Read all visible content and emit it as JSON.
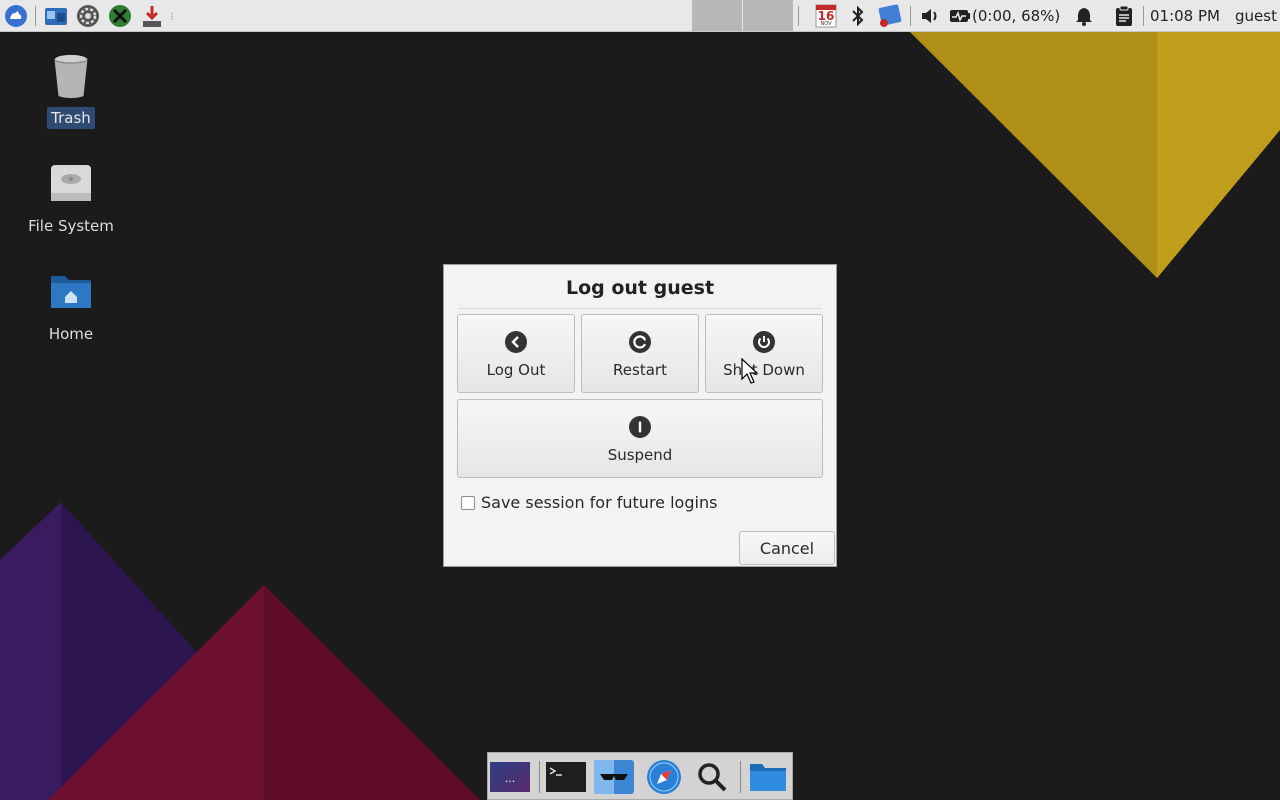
{
  "top_panel": {
    "calendar": {
      "month_top": "SAT",
      "day": "16",
      "month": "NOV"
    },
    "battery_text": "(0:00, 68%)",
    "clock": "01:08 PM",
    "user": "guest",
    "launchers": [
      "whisker-menu-icon",
      "file-manager-icon",
      "settings-icon",
      "xfce-x-icon",
      "downloader-icon"
    ],
    "tray": [
      "bluetooth-icon",
      "network-icon",
      "volume-icon",
      "battery-icon",
      "notifications-icon",
      "clipboard-icon"
    ]
  },
  "desktop": {
    "icons": [
      {
        "label": "Trash",
        "icon": "trash-icon",
        "selected": true
      },
      {
        "label": "File System",
        "icon": "drive-icon"
      },
      {
        "label": "Home",
        "icon": "home-folder-icon"
      }
    ]
  },
  "dialog": {
    "title": "Log out guest",
    "buttons": [
      {
        "label": "Log Out",
        "icon": "logout-arrow-icon"
      },
      {
        "label": "Restart",
        "icon": "restart-icon"
      },
      {
        "label": "Shut Down",
        "icon": "power-icon"
      },
      {
        "label": "Suspend",
        "icon": "suspend-icon"
      }
    ],
    "checkbox": {
      "label": "Save session for future logins",
      "checked": false
    },
    "cancel_label": "Cancel"
  },
  "dock": {
    "items": [
      "workspace-preview-icon",
      "terminal-icon",
      "finder-icon",
      "browser-compass-icon",
      "search-icon",
      "folder-icon"
    ],
    "workspace_label": "..."
  },
  "colors": {
    "desktop_bg": "#1b1b1b",
    "yellow": "#b8961b",
    "purple": "#3a1b5c",
    "crimson": "#7a1233",
    "selected_label": "#2f4b73"
  }
}
